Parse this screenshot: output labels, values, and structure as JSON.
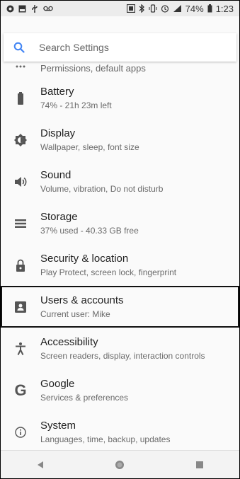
{
  "status_bar": {
    "battery_percent": "74%",
    "time": "1:23",
    "icons": [
      "notification-dot-icon",
      "gallery-icon",
      "usb-icon",
      "voicemail-icon",
      "nfc-icon",
      "bluetooth-icon",
      "vibrate-icon",
      "alarm-icon",
      "signal-icon",
      "battery-icon"
    ]
  },
  "search": {
    "placeholder": "Search Settings",
    "icon": "search-icon"
  },
  "partial_item": {
    "icon": "more-icon",
    "subtitle": "Permissions, default apps"
  },
  "items": [
    {
      "id": "battery",
      "icon": "battery-icon",
      "title": "Battery",
      "subtitle": "74% - 21h 23m left"
    },
    {
      "id": "display",
      "icon": "brightness-icon",
      "title": "Display",
      "subtitle": "Wallpaper, sleep, font size"
    },
    {
      "id": "sound",
      "icon": "volume-icon",
      "title": "Sound",
      "subtitle": "Volume, vibration, Do not disturb"
    },
    {
      "id": "storage",
      "icon": "storage-icon",
      "title": "Storage",
      "subtitle": "37% used - 40.33 GB free"
    },
    {
      "id": "security",
      "icon": "lock-icon",
      "title": "Security & location",
      "subtitle": "Play Protect, screen lock, fingerprint"
    },
    {
      "id": "users",
      "icon": "account-box-icon",
      "title": "Users & accounts",
      "subtitle": "Current user: Mike",
      "selected": true
    },
    {
      "id": "accessibility",
      "icon": "accessibility-icon",
      "title": "Accessibility",
      "subtitle": "Screen readers, display, interaction controls"
    },
    {
      "id": "google",
      "icon": "google-icon",
      "title": "Google",
      "subtitle": "Services & preferences"
    },
    {
      "id": "system",
      "icon": "info-icon",
      "title": "System",
      "subtitle": "Languages, time, backup, updates"
    }
  ],
  "nav_bar": {
    "buttons": [
      "back-icon",
      "home-icon",
      "recents-icon"
    ]
  },
  "colors": {
    "background": "#fafafa",
    "status_bar": "#ececec",
    "accent": "#4285f4",
    "selection_border": "#111111"
  }
}
